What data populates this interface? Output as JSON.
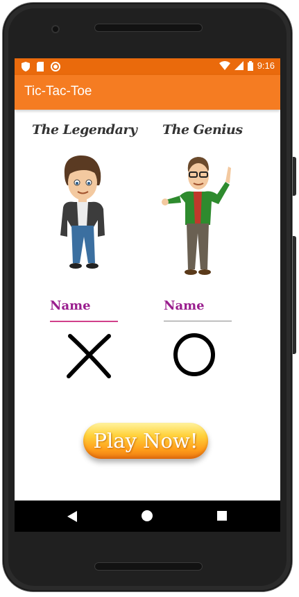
{
  "status_bar": {
    "time": "9:16",
    "icons_left": [
      "shield-icon",
      "sim-card-icon",
      "record-icon"
    ],
    "icons_right": [
      "wifi-icon",
      "cell-signal-icon",
      "battery-icon"
    ]
  },
  "app_bar": {
    "title": "Tic-Tac-Toe"
  },
  "players": [
    {
      "title": "The Legendary",
      "avatar": "man-avatar-icon",
      "name_placeholder": "Name",
      "mark": "X"
    },
    {
      "title": "The Genius",
      "avatar": "man-glasses-avatar-icon",
      "name_placeholder": "Name",
      "mark": "O"
    }
  ],
  "play_button": {
    "label": "Play Now!"
  },
  "nav_bar": {
    "buttons": [
      "back-icon",
      "home-icon",
      "recents-icon"
    ]
  },
  "colors": {
    "status_bar": "#ea6a0c",
    "app_bar": "#f57c22",
    "name_label": "#9a1e8e",
    "name_underline_active": "#d0408a",
    "name_underline_inactive": "#888888"
  }
}
